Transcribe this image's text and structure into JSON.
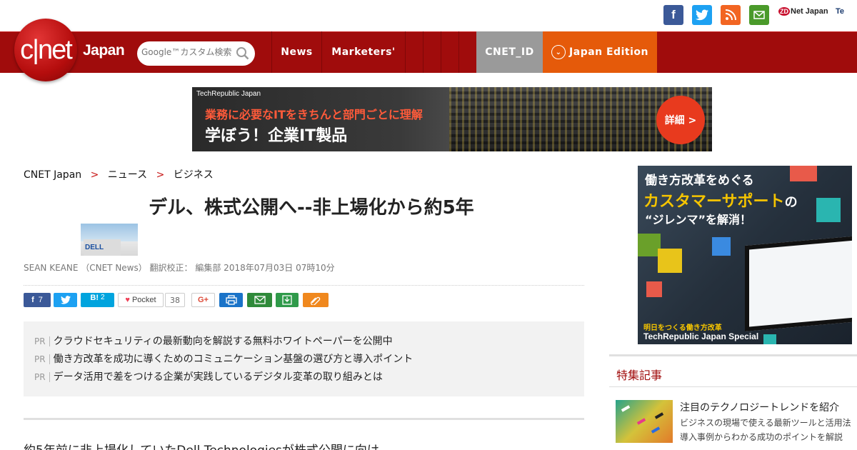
{
  "social": {
    "zdnet_label": "Net Japan",
    "zdnet_prefix": "ZD",
    "techrepublic_label": "Te"
  },
  "header": {
    "logo_text": "c|net",
    "edition": "Japan",
    "search_placeholder": "Google™カスタム検索",
    "nav": {
      "news": "News",
      "marketers": "Marketers'",
      "cnet_id": "CNET_ID",
      "edition": "Japan Edition"
    }
  },
  "banner": {
    "brand": "TechRepublic Japan",
    "line1": "業務に必要なITをきちんと部門ごとに理解",
    "line2": "学ぼう！企業IT製品",
    "cta": "詳細 >"
  },
  "breadcrumb": {
    "home": "CNET Japan",
    "level1": "ニュース",
    "level2": "ビジネス"
  },
  "article": {
    "headline": "デル、株式公開へ--非上場化から約5年",
    "byline": "SEAN KEANE （CNET News） 翻訳校正： 編集部 2018年07月03日 07時10分",
    "body_start": "約5年前に非上場化していたDell Technologiesが株式公開に向け"
  },
  "share": {
    "facebook_count": "7",
    "hatena_label": "B!",
    "hatena_count": "2",
    "pocket_label": "Pocket",
    "pocket_count": "38",
    "gplus_label": "G+"
  },
  "pr": {
    "tag": "PR",
    "items": [
      "クラウドセキュリティの最新動向を解説する無料ホワイトペーパーを公開中",
      "働き方改革を成功に導くためのコミュニケーション基盤の選び方と導入ポイント",
      "データ活用で差をつける企業が実践しているデジタル変革の取り組みとは"
    ]
  },
  "sidead": {
    "line1": "働き方改革をめぐる",
    "line2": "カスタマーサポート",
    "line2_suffix": "の",
    "line3": "“ジレンマ”を解消！",
    "footer1": "明日をつくる働き方改革",
    "footer2": "TechRepublic Japan Special"
  },
  "sidebar": {
    "section_title": "特集記事",
    "item": {
      "title": "注目のテクノロジートレンドを紹介",
      "desc1": "ビジネスの現場で使える最新ツールと活用法",
      "desc2": "導入事例からわかる成功のポイントを解説"
    }
  },
  "colors": {
    "nav_red": "#a00c0c",
    "cnet_id_gray": "#9a9a9a",
    "edition_orange": "#e55a0a",
    "facebook": "#3b5998",
    "twitter": "#1da1f2",
    "rss": "#f26522",
    "mail": "#4a9a2a"
  }
}
